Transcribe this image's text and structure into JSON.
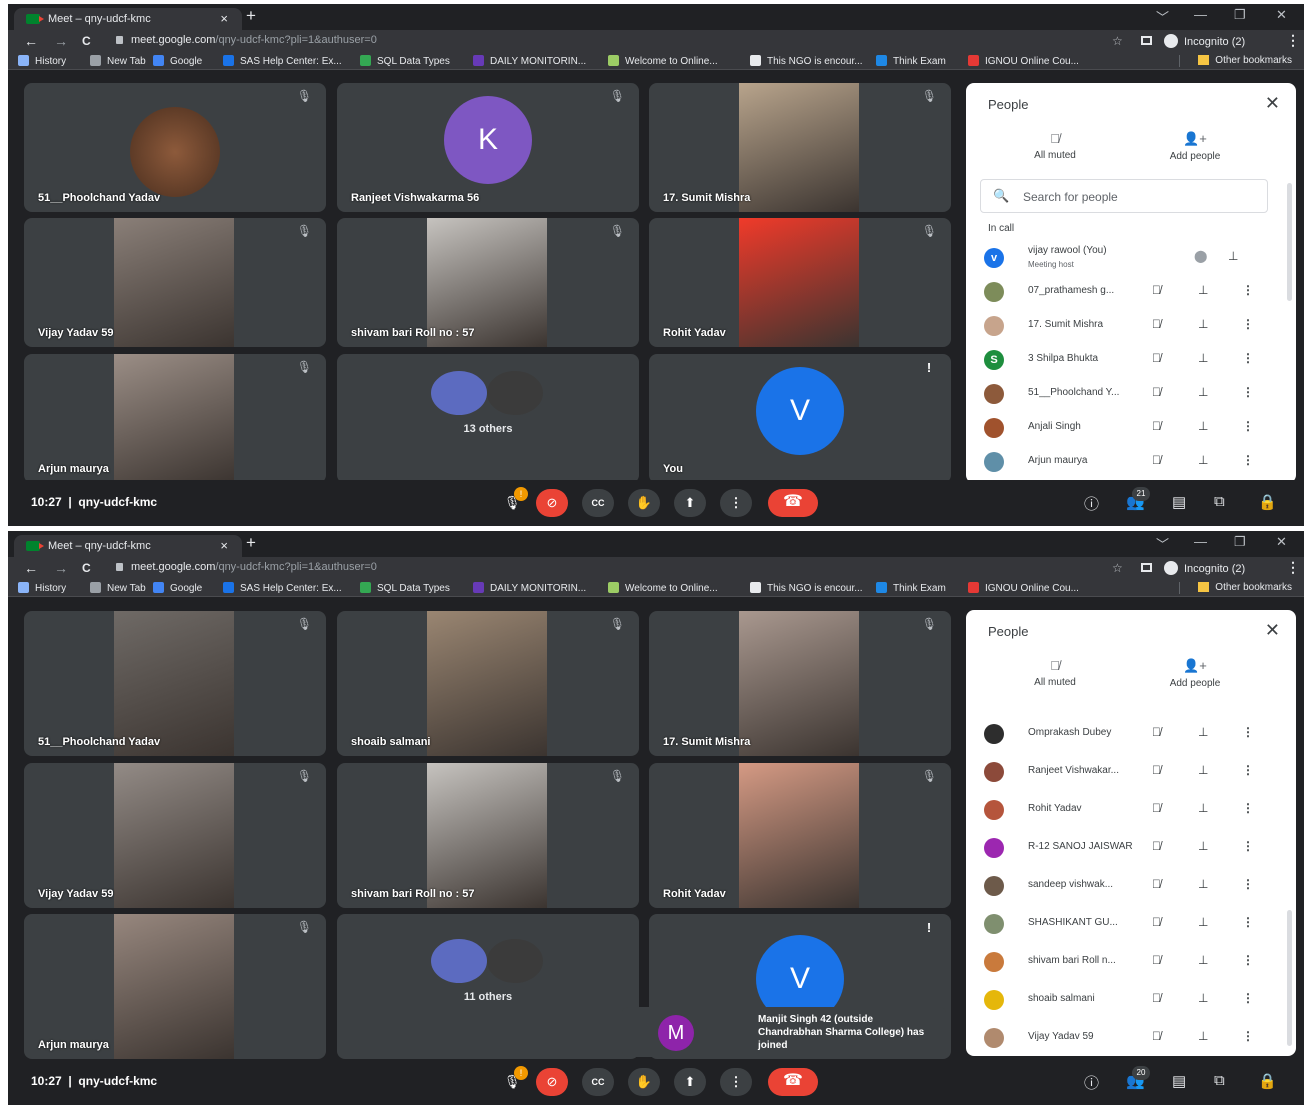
{
  "browser": {
    "tab_title": "Meet – qny-udcf-kmc",
    "tab_close": "×",
    "new_tab": "+",
    "window_controls": [
      "﹀",
      "—",
      "❐",
      "✕"
    ],
    "nav": [
      "←",
      "→",
      "C"
    ],
    "url_host": "meet.google.com",
    "url_path": "/qny-udcf-kmc?pli=1&authuser=0",
    "star": "☆",
    "profile_label": "Incognito (2)",
    "menu": "⋮",
    "bookmarks": [
      {
        "label": "History",
        "color": "#8ab4f8"
      },
      {
        "label": "New Tab",
        "color": "#9aa0a6"
      },
      {
        "label": "Google",
        "color": "#4285f4"
      },
      {
        "label": "SAS Help Center: Ex...",
        "color": "#1a73e8"
      },
      {
        "label": "SQL Data Types",
        "color": "#34a853"
      },
      {
        "label": "DAILY MONITORIN...",
        "color": "#673ab7"
      },
      {
        "label": "Welcome to Online...",
        "color": "#9ccc65"
      },
      {
        "label": "This NGO is encour...",
        "color": "#e8eaed"
      },
      {
        "label": "Think Exam",
        "color": "#1e88e5"
      },
      {
        "label": "IGNOU Online Cou...",
        "color": "#e53935"
      }
    ],
    "other_bookmarks": "Other bookmarks"
  },
  "meeting": {
    "time": "10:27",
    "separator": "|",
    "code": "qny-udcf-kmc"
  },
  "controls": {
    "mic_warning": "!",
    "camera": "⊘",
    "captions": "CC",
    "raise_hand": "✋",
    "present": "⬆",
    "more": "⋮",
    "leave": "☎",
    "info": "ⓘ",
    "people": "👥",
    "chat": "▤",
    "activities": "⧉",
    "host_controls": "🔒"
  },
  "screen1": {
    "people_count": "21",
    "tiles": [
      {
        "name": "51__Phoolchand Yadav",
        "type": "photo",
        "color": "#8d5a3b"
      },
      {
        "name": "Ranjeet Vishwakarma 56",
        "type": "letter",
        "letter": "K",
        "color": "#7e57c2"
      },
      {
        "name": "17. Sumit Mishra",
        "type": "video",
        "color": "#b8a48c"
      },
      {
        "name": "Vijay Yadav 59",
        "type": "video",
        "color": "#8a7f78"
      },
      {
        "name": "shivam bari Roll no : 57",
        "type": "video",
        "color": "#c6c3bf"
      },
      {
        "name": "Rohit Yadav",
        "type": "video",
        "color": "#f03a2a"
      },
      {
        "name": "Arjun maurya",
        "type": "video",
        "color": "#9b8e86"
      },
      {
        "name": "13 others",
        "type": "others"
      },
      {
        "name": "You",
        "type": "letter",
        "letter": "V",
        "color": "#1a73e8"
      }
    ],
    "panel": {
      "title": "People",
      "close": "✕",
      "all_muted": "All muted",
      "add_people": "Add people",
      "search_placeholder": "Search for people",
      "in_call": "In call",
      "rows": [
        {
          "name": "vijay rawool (You)",
          "sub": "Meeting host",
          "avatar": "v",
          "color": "#1a73e8"
        },
        {
          "name": "07_prathamesh g...",
          "avatar": "",
          "color": "#7d8c5a"
        },
        {
          "name": "17. Sumit Mishra",
          "avatar": "",
          "color": "#c7a48c"
        },
        {
          "name": "3 Shilpa Bhukta",
          "avatar": "S",
          "color": "#1e8e3e"
        },
        {
          "name": "51__Phoolchand Y...",
          "avatar": "",
          "color": "#8d5a3b"
        },
        {
          "name": "Anjali Singh",
          "avatar": "",
          "color": "#a0522d"
        },
        {
          "name": "Arjun maurya",
          "avatar": "",
          "color": "#5f8fa8"
        }
      ]
    }
  },
  "screen2": {
    "people_count": "20",
    "tiles": [
      {
        "name": "51__Phoolchand Yadav",
        "type": "video",
        "color": "#6f6a66"
      },
      {
        "name": "shoaib salmani",
        "type": "video",
        "color": "#9a8672"
      },
      {
        "name": "17. Sumit Mishra",
        "type": "video",
        "color": "#a9988f"
      },
      {
        "name": "Vijay Yadav 59",
        "type": "video",
        "color": "#938b86"
      },
      {
        "name": "shivam bari Roll no : 57",
        "type": "video",
        "color": "#c6c3bf"
      },
      {
        "name": "Rohit Yadav",
        "type": "video",
        "color": "#d59a84"
      },
      {
        "name": "Arjun maurya",
        "type": "video",
        "color": "#97877e"
      },
      {
        "name": "11 others",
        "type": "others"
      },
      {
        "name": "",
        "type": "letter",
        "letter": "V",
        "color": "#1a73e8"
      }
    ],
    "toast": {
      "letter": "M",
      "text": "Manjit Singh 42 (outside Chandrabhan Sharma College) has joined"
    },
    "panel": {
      "title": "People",
      "close": "✕",
      "all_muted": "All muted",
      "add_people": "Add people",
      "rows": [
        {
          "name": "Omprakash Dubey",
          "avatar": "",
          "color": "#2d2d2d"
        },
        {
          "name": "Ranjeet Vishwakar...",
          "avatar": "",
          "color": "#8c4a3a"
        },
        {
          "name": "Rohit Yadav",
          "avatar": "",
          "color": "#b5553c"
        },
        {
          "name": "R-12 SANOJ JAISWAR",
          "avatar": "",
          "color": "#9c27b0"
        },
        {
          "name": "sandeep vishwak...",
          "avatar": "",
          "color": "#6d5a4a"
        },
        {
          "name": "SHASHIKANT GU...",
          "avatar": "",
          "color": "#7f8f6f"
        },
        {
          "name": "shivam bari Roll n...",
          "avatar": "",
          "color": "#c97a3c"
        },
        {
          "name": "shoaib salmani",
          "avatar": "",
          "color": "#e5b70b"
        },
        {
          "name": "Vijay Yadav 59",
          "avatar": "",
          "color": "#b08a6e"
        }
      ]
    }
  }
}
